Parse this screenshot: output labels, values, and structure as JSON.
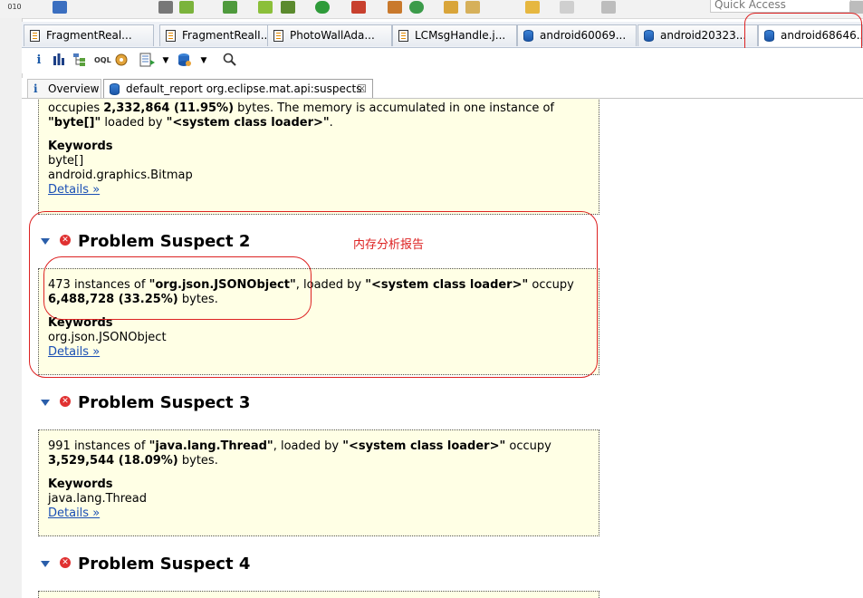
{
  "toolbar": {
    "quick_access_placeholder": "Quick Access"
  },
  "editor_tabs": [
    {
      "label": "FragmentReal...",
      "icon": "java-file-icon"
    },
    {
      "label": "FragmentRealI...",
      "icon": "java-file-icon"
    },
    {
      "label": "PhotoWallAda...",
      "icon": "java-file-icon"
    },
    {
      "label": "LCMsgHandle.j...",
      "icon": "java-file-icon"
    },
    {
      "label": "android60069...",
      "icon": "heap-dump-icon"
    },
    {
      "label": "android20323...",
      "icon": "heap-dump-icon"
    },
    {
      "label": "android68646...",
      "icon": "heap-dump-icon",
      "active": true
    }
  ],
  "view_tabs": {
    "overview": "Overview",
    "report": "default_report  org.eclipse.mat.api:suspects",
    "report_close": "☒"
  },
  "suspect1_partial": {
    "line1_pre": "occupies ",
    "line1_bytes": "2,332,864 (11.95%)",
    "line1_post": " bytes. The memory is accumulated in one instance of",
    "line2_class": "\"byte[]\"",
    "line2_mid": " loaded by ",
    "line2_loader": "\"<system class loader>\"",
    "line2_end": ".",
    "keywords_title": "Keywords",
    "keywords": [
      "byte[]",
      "android.graphics.Bitmap"
    ],
    "details": "Details »"
  },
  "suspects": [
    {
      "title": "Problem Suspect 2",
      "count_text": "473 instances of ",
      "class_name": "\"org.json.JSONObject\"",
      "loaded_by": ", loaded by ",
      "loader": "\"<system class loader>\"",
      "occupy": " occupy",
      "bytes": "6,488,728 (33.25%)",
      "bytes_suffix": " bytes.",
      "keywords_title": "Keywords",
      "keyword": "org.json.JSONObject",
      "details": "Details »"
    },
    {
      "title": "Problem Suspect 3",
      "count_text": "991 instances of ",
      "class_name": "\"java.lang.Thread\"",
      "loaded_by": ", loaded by ",
      "loader": "\"<system class loader>\"",
      "occupy": " occupy",
      "bytes": "3,529,544 (18.09%)",
      "bytes_suffix": " bytes.",
      "keywords_title": "Keywords",
      "keyword": "java.lang.Thread",
      "details": "Details »"
    },
    {
      "title": "Problem Suspect 4"
    }
  ],
  "annotation": {
    "text": "内存分析报告",
    "color": "#dd2222"
  },
  "colors": {
    "report_background": "#ffffe5",
    "link": "#1a4fb5",
    "error_icon": "#e03131"
  }
}
